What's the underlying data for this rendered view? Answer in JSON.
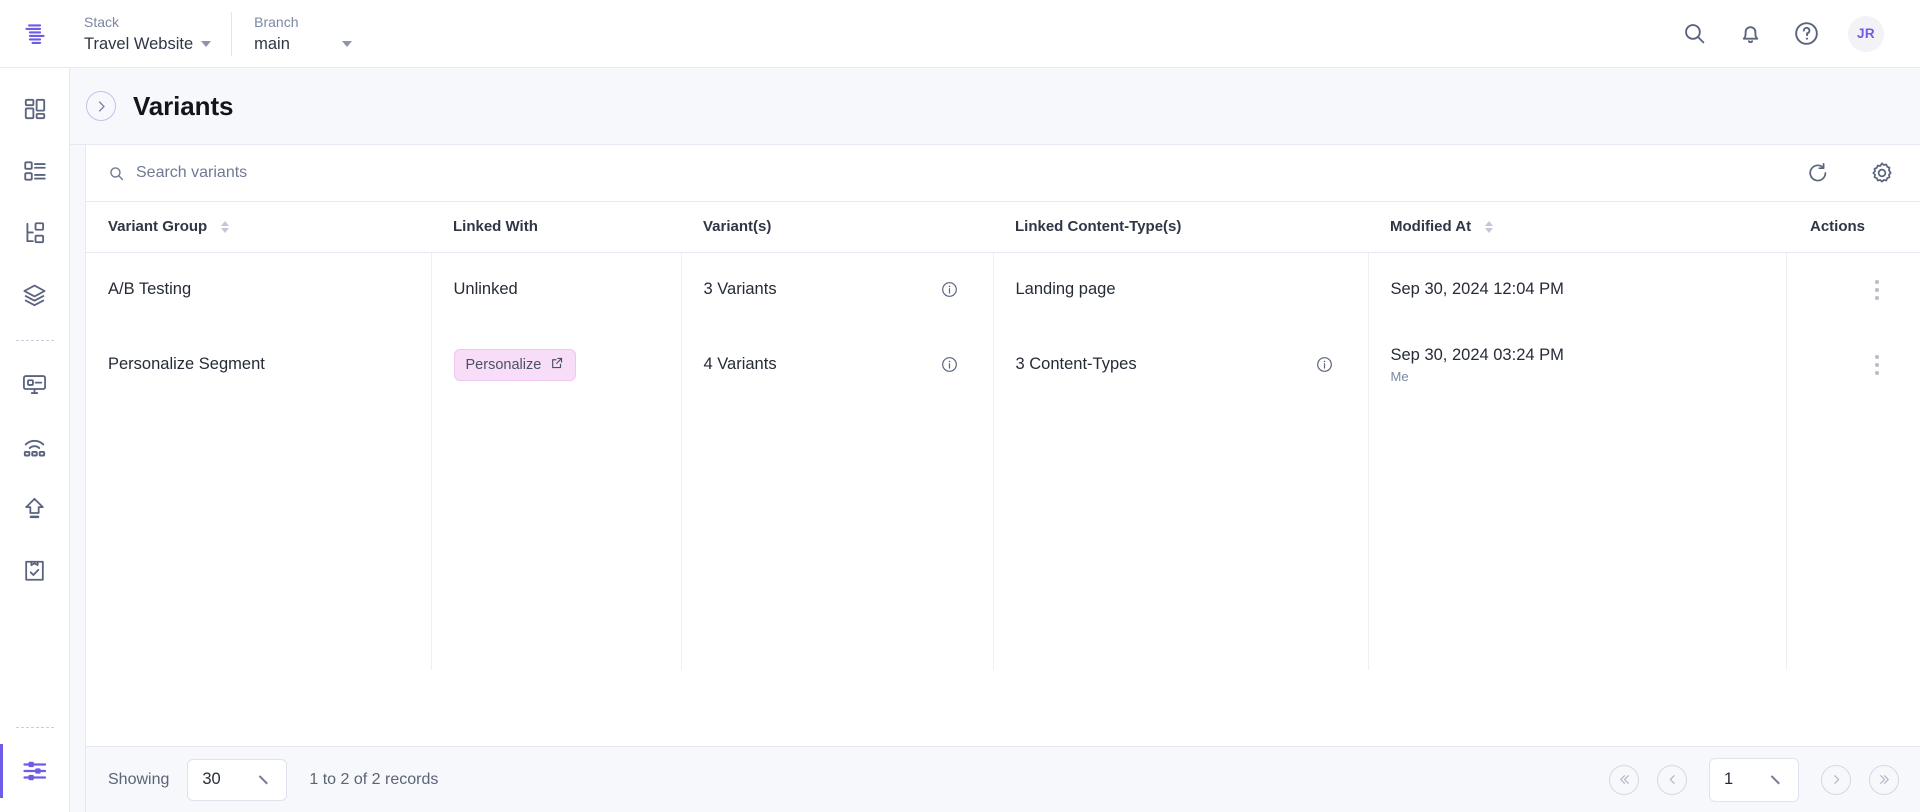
{
  "header": {
    "logo_icon": "contentstack-logo",
    "stack": {
      "label": "Stack",
      "value": "Travel Website"
    },
    "branch": {
      "label": "Branch",
      "value": "main"
    },
    "search_icon": "search-icon",
    "notifications_icon": "bell-icon",
    "help_icon": "help-circle-icon",
    "avatar_initials": "JR"
  },
  "sidebar": {
    "items": [
      {
        "name": "dashboard",
        "icon": "dashboard-grid-icon"
      },
      {
        "name": "content-types",
        "icon": "content-list-icon"
      },
      {
        "name": "entries",
        "icon": "hierarchy-icon"
      },
      {
        "name": "assets",
        "icon": "layers-icon"
      },
      {
        "name": "live-preview",
        "icon": "monitor-icon"
      },
      {
        "name": "releases",
        "icon": "broadcast-icon"
      },
      {
        "name": "publish-queue",
        "icon": "upload-icon"
      },
      {
        "name": "audit-log",
        "icon": "clipboard-check-icon"
      },
      {
        "name": "settings",
        "icon": "sliders-icon"
      }
    ],
    "active_item": "settings",
    "active_color": "#6c5ce7"
  },
  "page": {
    "back_icon": "chevron-right-circle-icon",
    "title": "Variants"
  },
  "toolbar": {
    "search_placeholder": "Search variants",
    "search_value": "",
    "search_icon": "search-icon",
    "refresh_icon": "refresh-icon",
    "settings_icon": "gear-icon"
  },
  "table": {
    "columns": [
      {
        "label": "Variant Group",
        "sortable": true
      },
      {
        "label": "Linked With",
        "sortable": false
      },
      {
        "label": "Variant(s)",
        "sortable": false
      },
      {
        "label": "Linked Content-Type(s)",
        "sortable": false
      },
      {
        "label": "Modified At",
        "sortable": true
      },
      {
        "label": "Actions",
        "sortable": false
      }
    ],
    "rows": [
      {
        "variant_group": "A/B Testing",
        "linked_with": {
          "type": "text",
          "text": "Unlinked"
        },
        "variants": "3 Variants",
        "variants_info_icon": "info-icon",
        "content_types": "Landing page",
        "content_types_info_icon": "",
        "modified_at": "Sep 30, 2024 12:04 PM",
        "modified_by": "",
        "actions_icon": "kebab-menu-icon"
      },
      {
        "variant_group": "Personalize Segment",
        "linked_with": {
          "type": "badge",
          "text": "Personalize",
          "icon": "external-link-icon",
          "bg": "#f7ddf7",
          "border": "#eec6ee"
        },
        "variants": "4 Variants",
        "variants_info_icon": "info-icon",
        "content_types": "3 Content-Types",
        "content_types_info_icon": "info-icon",
        "modified_at": "Sep 30, 2024 03:24 PM",
        "modified_by": "Me",
        "actions_icon": "kebab-menu-icon"
      }
    ]
  },
  "footer": {
    "showing_label": "Showing",
    "page_size": "30",
    "records_text": "1 to 2 of 2 records",
    "first_icon": "double-chevron-left-icon",
    "prev_icon": "chevron-left-icon",
    "current_page": "1",
    "next_icon": "chevron-right-icon",
    "last_icon": "double-chevron-right-icon"
  }
}
